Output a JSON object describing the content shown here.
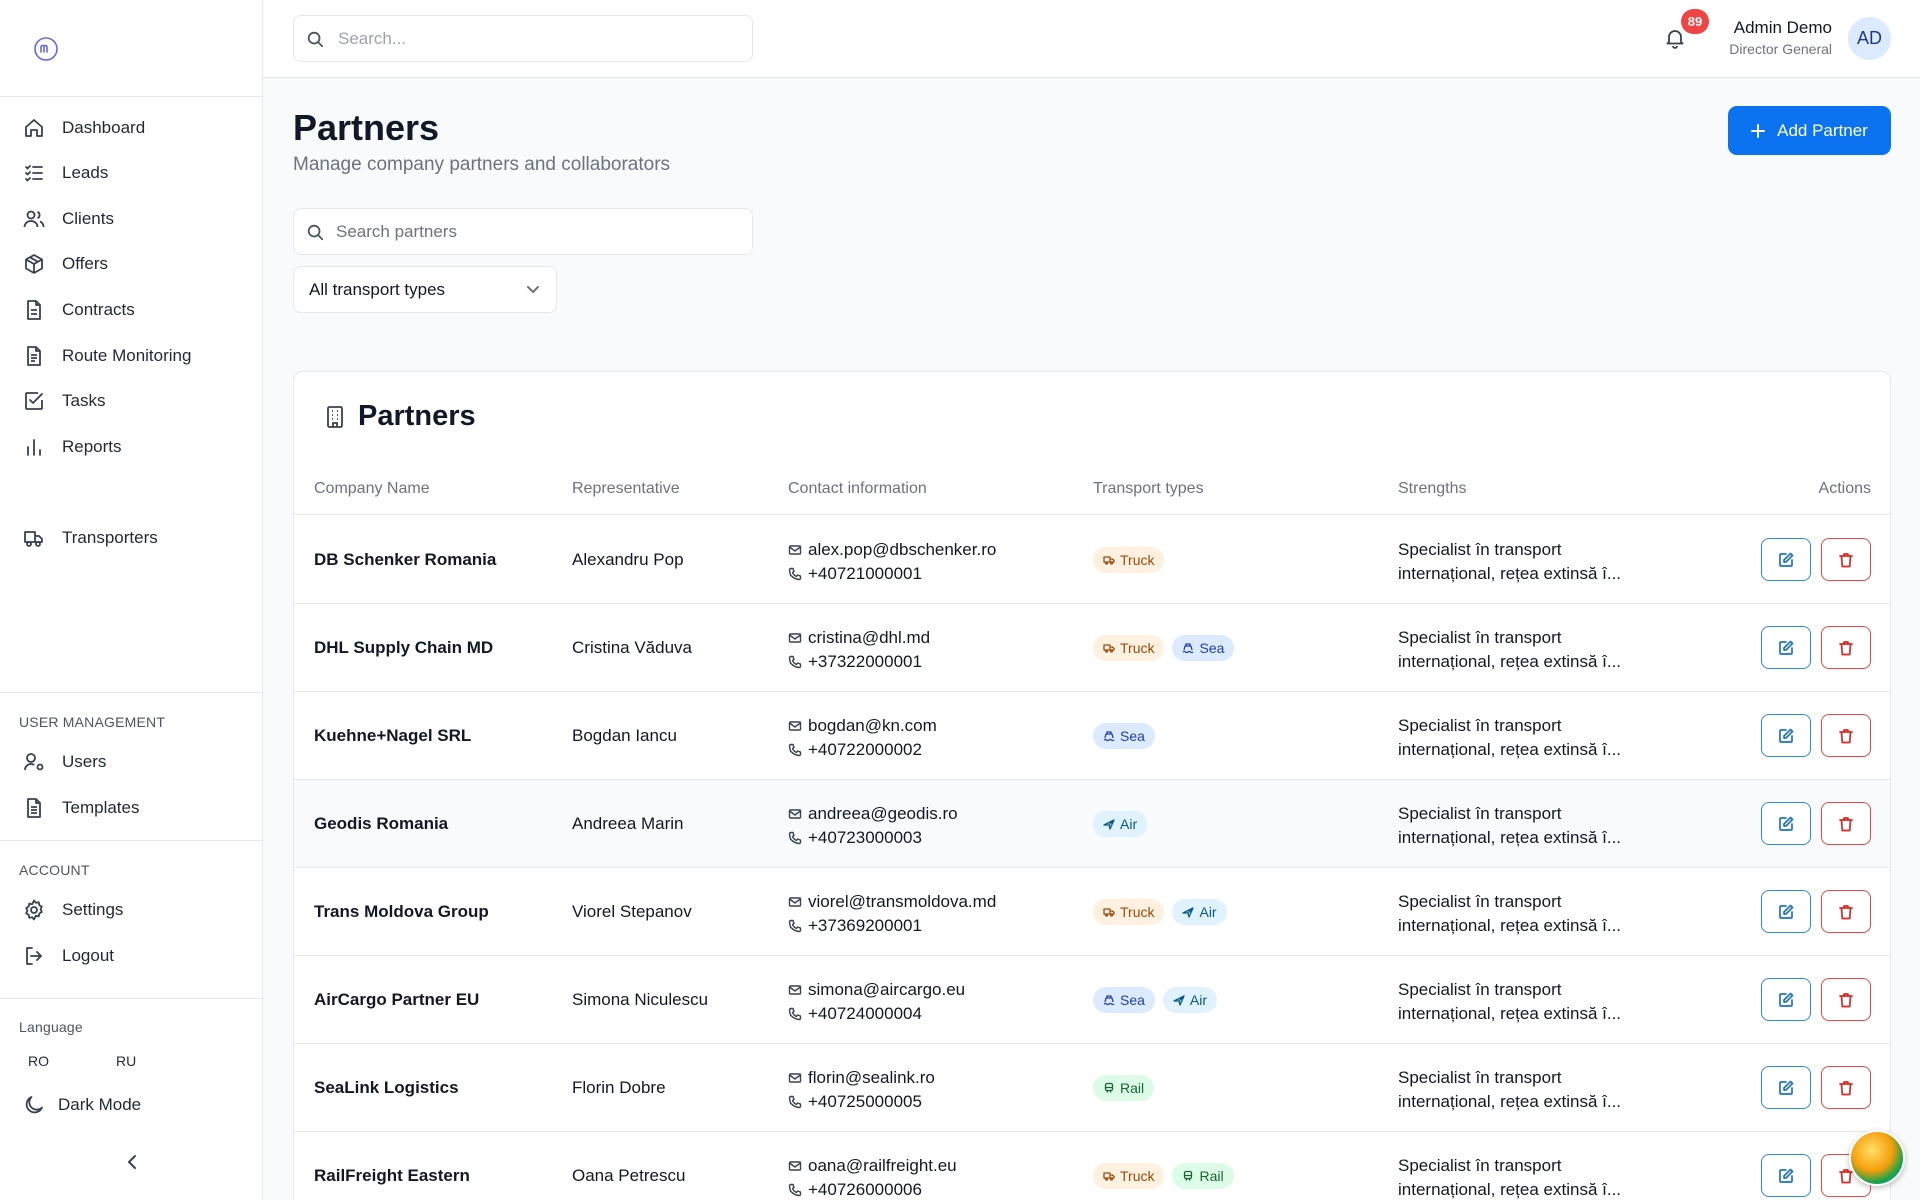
{
  "sidebar": {
    "nav": [
      {
        "label": "Dashboard",
        "icon": "home-icon"
      },
      {
        "label": "Leads",
        "icon": "list-check-icon"
      },
      {
        "label": "Clients",
        "icon": "users-icon"
      },
      {
        "label": "Offers",
        "icon": "package-icon"
      },
      {
        "label": "Contracts",
        "icon": "file-icon"
      },
      {
        "label": "Route Monitoring",
        "icon": "file-text-icon"
      },
      {
        "label": "Tasks",
        "icon": "checkbox-icon"
      },
      {
        "label": "Reports",
        "icon": "bar-chart-icon"
      },
      {
        "label": "Transporters",
        "icon": "truck-icon"
      }
    ],
    "user_management_title": "USER MANAGEMENT",
    "user_management": [
      {
        "label": "Users",
        "icon": "user-cog-icon"
      },
      {
        "label": "Templates",
        "icon": "file-template-icon"
      }
    ],
    "account_title": "ACCOUNT",
    "account": [
      {
        "label": "Settings",
        "icon": "gear-icon"
      },
      {
        "label": "Logout",
        "icon": "logout-icon"
      }
    ],
    "language_title": "Language",
    "languages": [
      "RO",
      "RU"
    ],
    "dark_mode_label": "Dark Mode"
  },
  "topbar": {
    "search_placeholder": "Search...",
    "notification_count": "89",
    "user_name": "Admin Demo",
    "user_role": "Director General",
    "avatar_initials": "AD"
  },
  "page": {
    "title": "Partners",
    "subtitle": "Manage company partners and collaborators",
    "add_button": "Add Partner",
    "search_placeholder": "Search partners",
    "transport_filter": "All transport types"
  },
  "table": {
    "title": "Partners",
    "columns": [
      "Company Name",
      "Representative",
      "Contact information",
      "Transport types",
      "Strengths",
      "Actions"
    ],
    "strengths_line1": "Specialist în transport",
    "strengths_line2": "internațional, rețea extinsă î...",
    "rows": [
      {
        "company": "DB Schenker Romania",
        "rep": "Alexandru Pop",
        "email": "alex.pop@dbschenker.ro",
        "phone": "+40721000001",
        "types": [
          "Truck"
        ]
      },
      {
        "company": "DHL Supply Chain MD",
        "rep": "Cristina Văduva",
        "email": "cristina@dhl.md",
        "phone": "+37322000001",
        "types": [
          "Truck",
          "Sea"
        ]
      },
      {
        "company": "Kuehne+Nagel SRL",
        "rep": "Bogdan Iancu",
        "email": "bogdan@kn.com",
        "phone": "+40722000002",
        "types": [
          "Sea"
        ]
      },
      {
        "company": "Geodis Romania",
        "rep": "Andreea Marin",
        "email": "andreea@geodis.ro",
        "phone": "+40723000003",
        "types": [
          "Air"
        ]
      },
      {
        "company": "Trans Moldova Group",
        "rep": "Viorel Stepanov",
        "email": "viorel@transmoldova.md",
        "phone": "+37369200001",
        "types": [
          "Truck",
          "Air"
        ]
      },
      {
        "company": "AirCargo Partner EU",
        "rep": "Simona Niculescu",
        "email": "simona@aircargo.eu",
        "phone": "+40724000004",
        "types": [
          "Sea",
          "Air"
        ]
      },
      {
        "company": "SeaLink Logistics",
        "rep": "Florin Dobre",
        "email": "florin@sealink.ro",
        "phone": "+40725000005",
        "types": [
          "Rail"
        ]
      },
      {
        "company": "RailFreight Eastern",
        "rep": "Oana Petrescu",
        "email": "oana@railfreight.eu",
        "phone": "+40726000006",
        "types": [
          "Truck",
          "Rail"
        ]
      }
    ]
  },
  "colors": {
    "primary": "#0b72f0",
    "danger": "#ef4444",
    "truck_tag": "#fff1e0",
    "sea_tag": "#dbeafe",
    "air_tag": "#e0f2fe",
    "rail_tag": "#dcfce7"
  }
}
